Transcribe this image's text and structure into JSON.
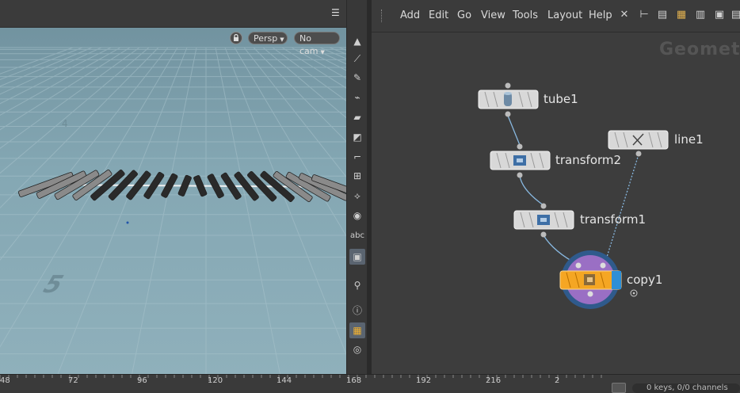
{
  "viewport": {
    "camera_menu": "Persp",
    "cam_menu": "No cam",
    "lock_icon": "lock-icon",
    "grid_numbers": [
      "4",
      "5"
    ]
  },
  "topbar": {
    "list_icon": "view-list-icon",
    "help_icon": "help-icon"
  },
  "shelf": {
    "text_tool_label": "abc",
    "icons": [
      "arrow-up-icon",
      "brush-icon",
      "pen-icon",
      "brush-12-icon",
      "paint-icon",
      "grid-12-icon",
      "angle-icon",
      "snap-grid-icon",
      "snap-point-icon",
      "sphere-icon",
      "abc-icon",
      "image-icon",
      "pin-icon",
      "info-icon",
      "layout-grid-icon",
      "eye-icon"
    ]
  },
  "network": {
    "menus": [
      "Add",
      "Edit",
      "Go",
      "View",
      "Tools",
      "Layout",
      "Help"
    ],
    "context_label": "Geometry",
    "nodes": [
      {
        "name": "tube1",
        "icon": "tube-icon"
      },
      {
        "name": "transform2",
        "icon": "transform-icon"
      },
      {
        "name": "transform1",
        "icon": "transform-icon"
      },
      {
        "name": "line1",
        "icon": "line-icon"
      },
      {
        "name": "copy1",
        "icon": "copy-icon",
        "state": "display"
      }
    ],
    "colors": {
      "copy_node": "#f5a623",
      "display_flag": "#2f8fd6",
      "selection_ring": "#9a6fc4"
    }
  },
  "timeline": {
    "ticks": [
      "48",
      "72",
      "96",
      "120",
      "144",
      "168",
      "192",
      "216",
      "2"
    ],
    "keys_status": "0 keys, 0/0 channels"
  }
}
